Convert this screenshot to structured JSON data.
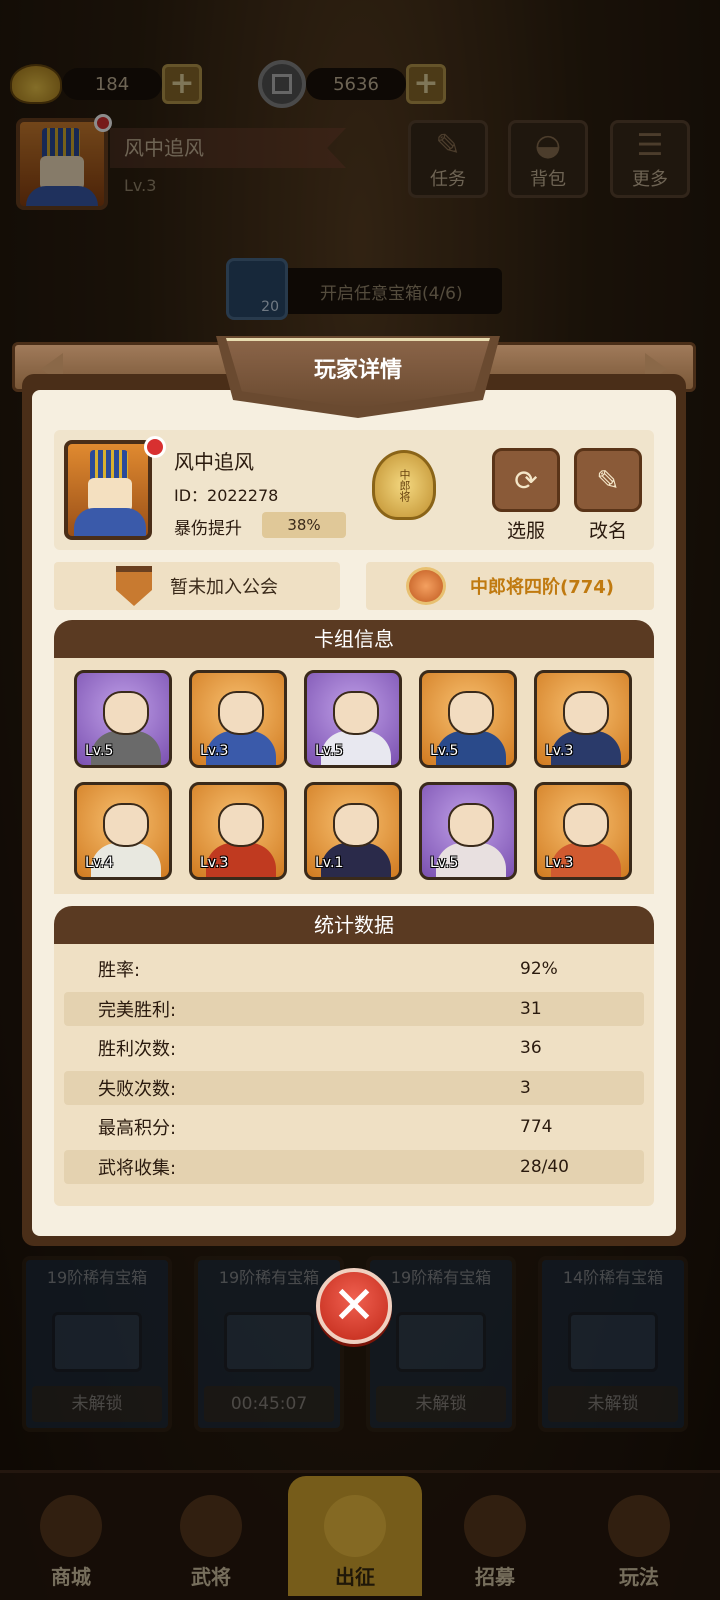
{
  "top_bar": {
    "gold_value": "184",
    "coin_value": "5636",
    "player_name": "风中追风",
    "player_level": "Lv.3",
    "buttons": [
      {
        "label": "任务",
        "icon": "scroll-icon"
      },
      {
        "label": "背包",
        "icon": "bag-icon"
      },
      {
        "label": "更多",
        "icon": "menu-icon"
      }
    ],
    "quest_text": "开启任意宝箱(4/6)",
    "quest_count": "20"
  },
  "modal": {
    "title": "玩家详情",
    "player": {
      "name": "风中追风",
      "id": "ID：2022278",
      "crit_label": "暴伤提升",
      "crit_value": "38%",
      "rank_badge": "中郎将",
      "switch_server": "选服",
      "rename": "改名"
    },
    "guild_text": "暂未加入公会",
    "rank_text": "中郎将四阶(774)",
    "deck_title": "卡组信息",
    "deck": [
      {
        "lv": "Lv.5",
        "rarity": "purple",
        "cloth": "#6a6a6a"
      },
      {
        "lv": "Lv.3",
        "rarity": "orange",
        "cloth": "#3a5aaa"
      },
      {
        "lv": "Lv.5",
        "rarity": "purple",
        "cloth": "#e8e8f0"
      },
      {
        "lv": "Lv.5",
        "rarity": "orange",
        "cloth": "#2a4a8a"
      },
      {
        "lv": "Lv.3",
        "rarity": "orange",
        "cloth": "#2a3a6a"
      },
      {
        "lv": "Lv.4",
        "rarity": "orange",
        "cloth": "#e8e8e0"
      },
      {
        "lv": "Lv.3",
        "rarity": "orange",
        "cloth": "#c03a20"
      },
      {
        "lv": "Lv.1",
        "rarity": "orange",
        "cloth": "#2a2a4a"
      },
      {
        "lv": "Lv.5",
        "rarity": "purple",
        "cloth": "#e8e0e0"
      },
      {
        "lv": "Lv.3",
        "rarity": "orange",
        "cloth": "#d05a30"
      }
    ],
    "stats_title": "统计数据",
    "stats": [
      {
        "label": "胜率:",
        "value": "92%"
      },
      {
        "label": "完美胜利:",
        "value": "31"
      },
      {
        "label": "胜利次数:",
        "value": "36"
      },
      {
        "label": "失败次数:",
        "value": "3"
      },
      {
        "label": "最高积分:",
        "value": "774"
      },
      {
        "label": "武将收集:",
        "value": "28/40"
      }
    ]
  },
  "chests": [
    {
      "title": "19阶稀有宝箱",
      "status": "未解锁"
    },
    {
      "title": "19阶稀有宝箱",
      "status": "00:45:07"
    },
    {
      "title": "19阶稀有宝箱",
      "status": "未解锁"
    },
    {
      "title": "14阶稀有宝箱",
      "status": "未解锁"
    }
  ],
  "bottom_nav": [
    {
      "label": "商城"
    },
    {
      "label": "武将"
    },
    {
      "label": "出征"
    },
    {
      "label": "招募"
    },
    {
      "label": "玩法"
    }
  ],
  "colors": {
    "accent": "#5a3a22",
    "close": "#d83020",
    "highlight": "#c8a020"
  }
}
